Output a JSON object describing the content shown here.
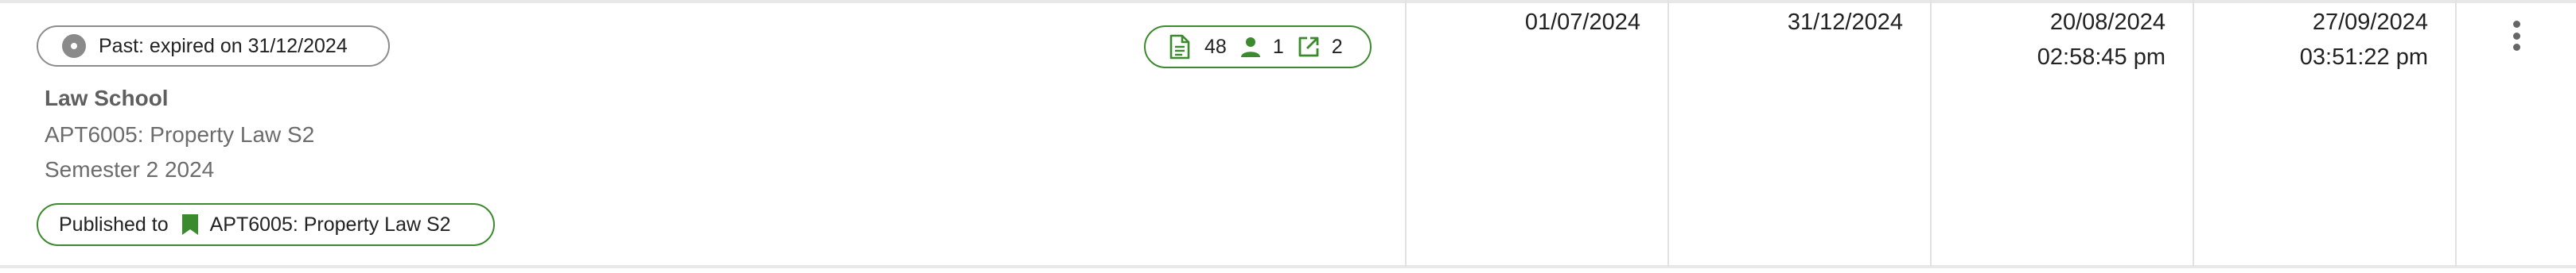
{
  "status": {
    "label": "Past: expired on 31/12/2024"
  },
  "stats": {
    "documents": "48",
    "people": "1",
    "shared": "2"
  },
  "course": {
    "school": "Law School",
    "code": "APT6005: Property Law S2",
    "term": "Semester 2 2024"
  },
  "published": {
    "prefix": "Published to",
    "target": "APT6005: Property Law S2"
  },
  "dates": {
    "start": "01/07/2024",
    "end": "31/12/2024",
    "created_date": "20/08/2024",
    "created_time": "02:58:45 pm",
    "modified_date": "27/09/2024",
    "modified_time": "03:51:22 pm"
  },
  "colors": {
    "accent_green": "#3b8a2e",
    "status_grey": "#8a8a8a",
    "divider": "#e2e2e2"
  },
  "icons": [
    "status-dot-icon",
    "document-icon",
    "person-icon",
    "open-external-icon",
    "bookmark-icon",
    "more-vert-icon"
  ]
}
